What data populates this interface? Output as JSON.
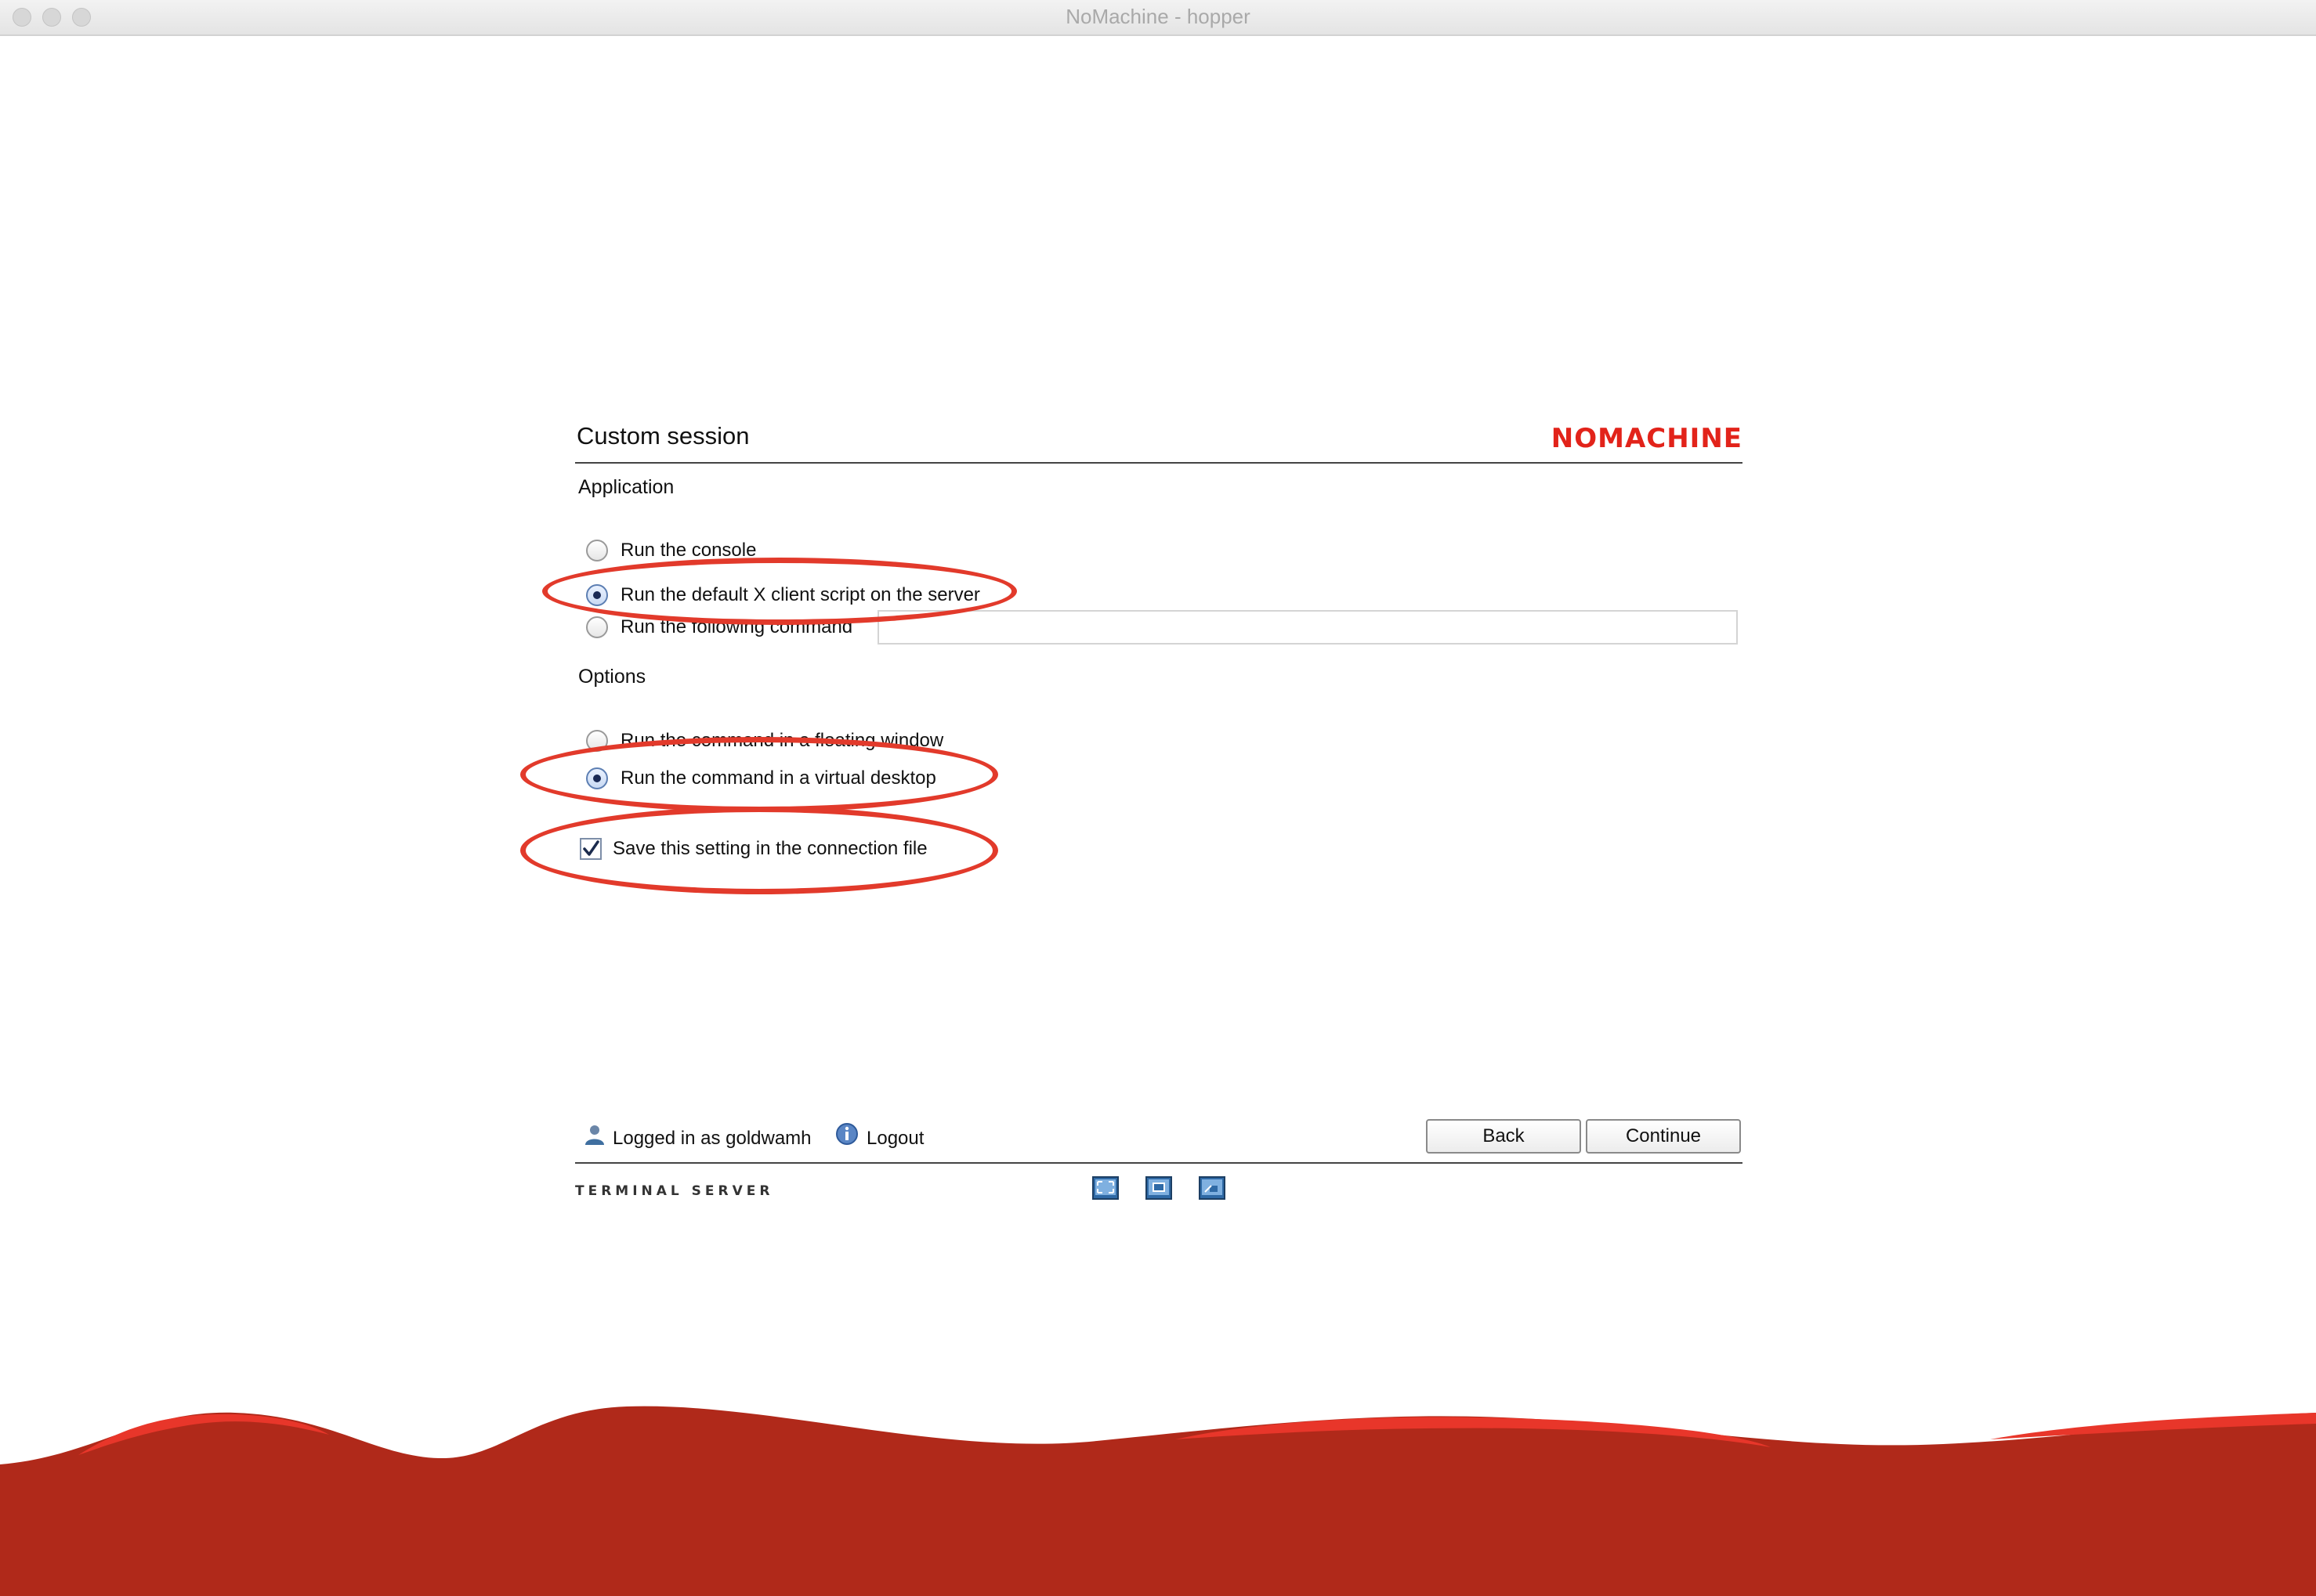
{
  "window": {
    "title": "NoMachine - hopper"
  },
  "header": {
    "title": "Custom session",
    "brand": "NOMACHINE"
  },
  "application": {
    "label": "Application",
    "options": [
      {
        "label": "Run the console",
        "checked": false
      },
      {
        "label": "Run the default X client script on the server",
        "checked": true
      },
      {
        "label": "Run the following command",
        "checked": false
      }
    ],
    "command_value": ""
  },
  "options": {
    "label": "Options",
    "items": [
      {
        "label": "Run the command in a floating window",
        "checked": false
      },
      {
        "label": "Run the command in a virtual desktop",
        "checked": true
      }
    ],
    "save_label": "Save this setting in the connection file",
    "save_checked": true
  },
  "footer": {
    "logged_in": "Logged in as goldwamh",
    "logout": "Logout",
    "back": "Back",
    "continue": "Continue",
    "product": "TERMINAL SERVER",
    "view_icons": [
      "fullscreen-icon",
      "fit-window-icon",
      "windowed-icon"
    ]
  },
  "colors": {
    "brand": "#e2231a",
    "annotation": "#e23a2b",
    "wave_dark": "#b0291a",
    "wave_light": "#e8362a"
  }
}
